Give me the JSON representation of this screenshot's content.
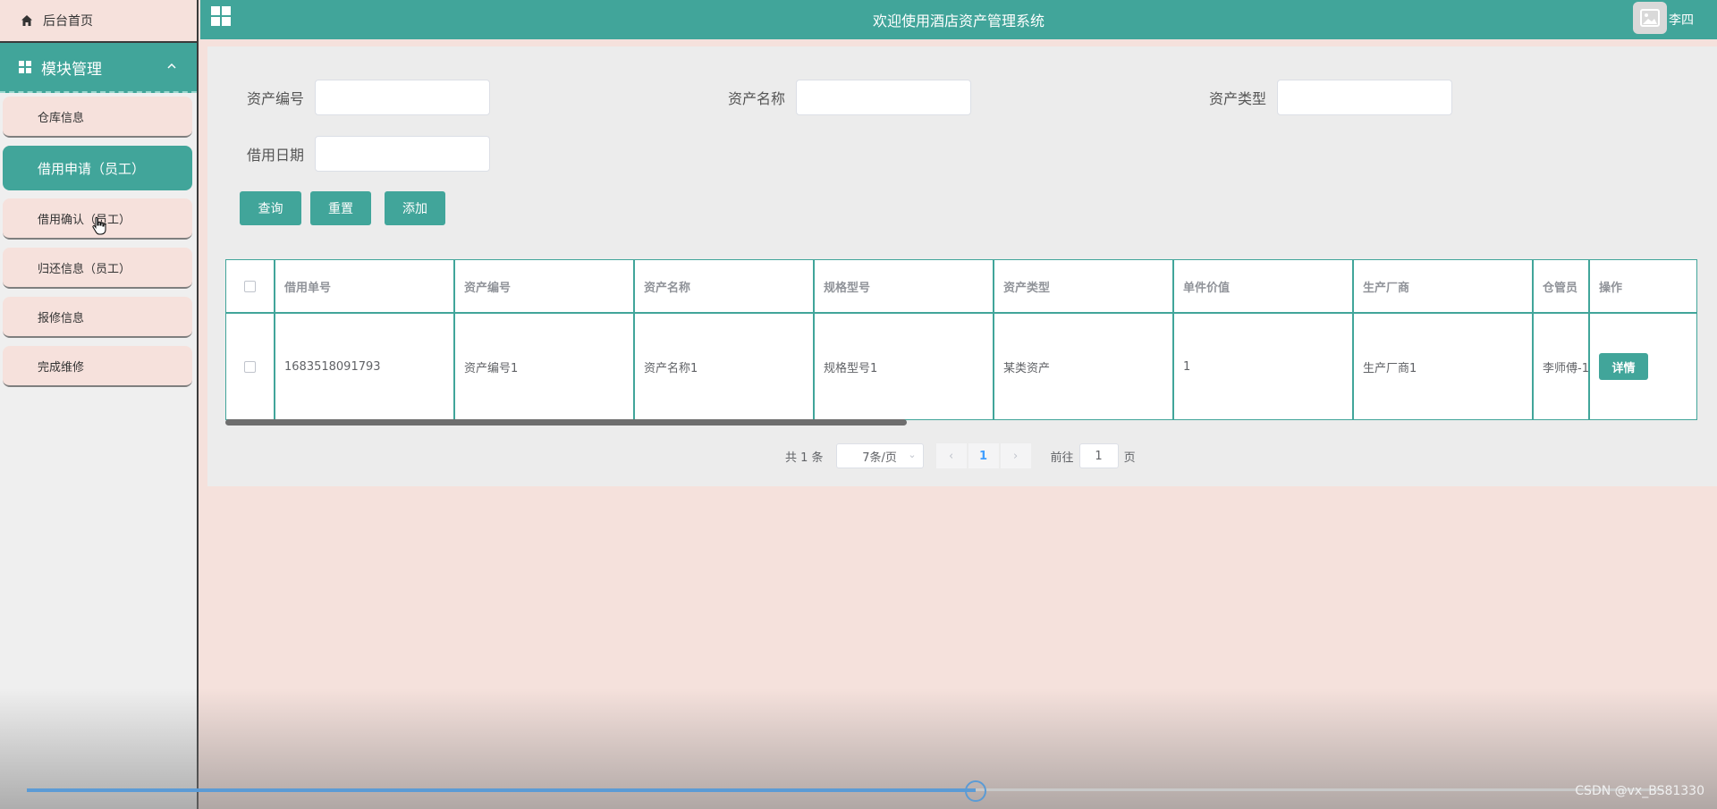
{
  "sidebar": {
    "home": "后台首页",
    "module": "模块管理",
    "items": [
      {
        "label": "仓库信息"
      },
      {
        "label": "借用申请（员工）"
      },
      {
        "label": "借用确认（员工）"
      },
      {
        "label": "归还信息（员工）"
      },
      {
        "label": "报修信息"
      },
      {
        "label": "完成维修"
      }
    ]
  },
  "header": {
    "title": "欢迎使用酒店资产管理系统",
    "user": "李四"
  },
  "search": {
    "fields": [
      {
        "label": "资产编号",
        "value": ""
      },
      {
        "label": "资产名称",
        "value": ""
      },
      {
        "label": "资产类型",
        "value": ""
      },
      {
        "label": "借用日期",
        "value": ""
      }
    ],
    "query": "查询",
    "reset": "重置",
    "add": "添加"
  },
  "table": {
    "headers": [
      "借用单号",
      "资产编号",
      "资产名称",
      "规格型号",
      "资产类型",
      "单件价值",
      "生产厂商",
      "仓管员",
      "操作"
    ],
    "rows": [
      {
        "cells": [
          "1683518091793",
          "资产编号1",
          "资产名称1",
          "规格型号1",
          "某类资产",
          "1",
          "生产厂商1",
          "李师傅-1"
        ],
        "action": "详情"
      }
    ]
  },
  "pager": {
    "total": "共 1 条",
    "size": "7条/页",
    "current": "1",
    "goto": "前往",
    "goto_value": "1",
    "page_suffix": "页"
  },
  "video": {
    "progress": 0.58,
    "watermark": "CSDN @vx_BS81330"
  },
  "colors": {
    "accent": "#41a59a",
    "panel": "#ececec",
    "background": "#f5e1dc"
  }
}
